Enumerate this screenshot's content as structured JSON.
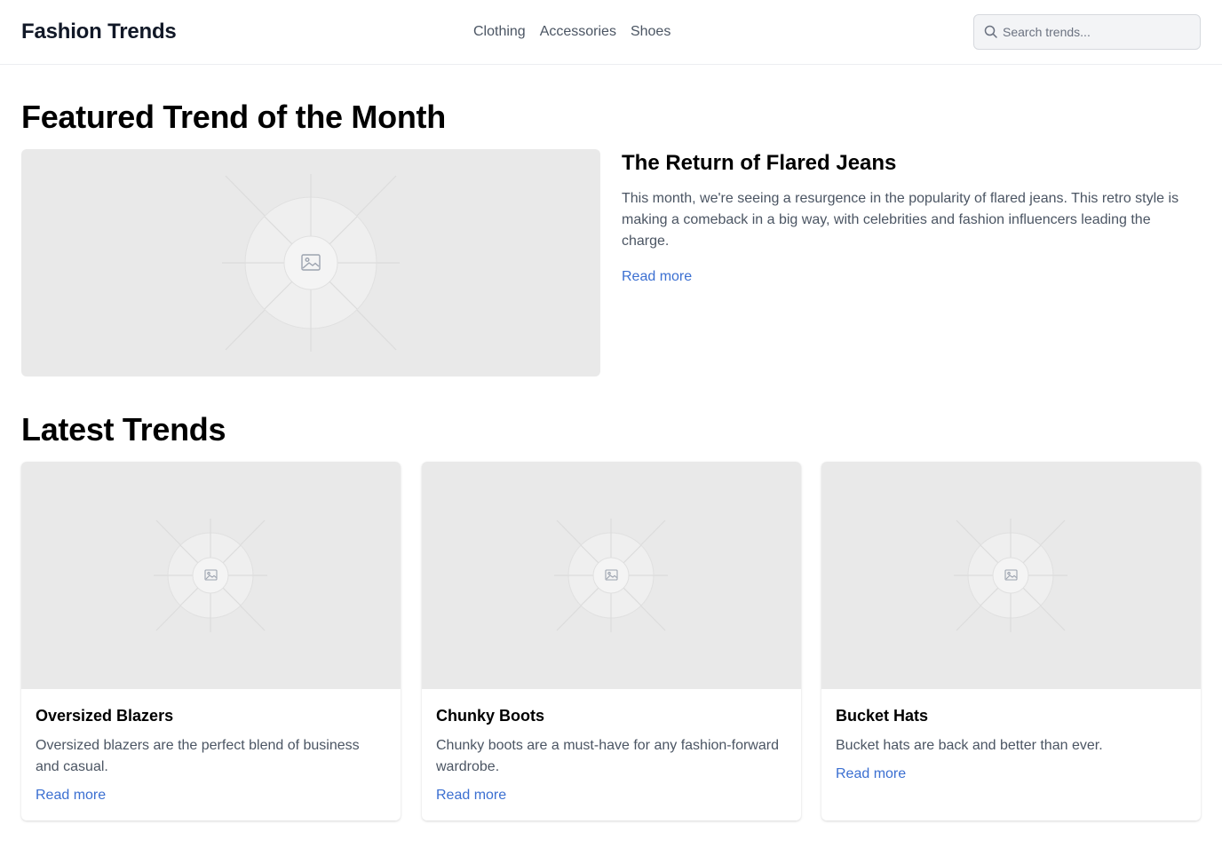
{
  "header": {
    "logo": "Fashion Trends",
    "nav": [
      "Clothing",
      "Accessories",
      "Shoes"
    ],
    "search_placeholder": "Search trends..."
  },
  "featured": {
    "section_title": "Featured Trend of the Month",
    "title": "The Return of Flared Jeans",
    "description": "This month, we're seeing a resurgence in the popularity of flared jeans. This retro style is making a comeback in a big way, with celebrities and fashion influencers leading the charge.",
    "link": "Read more"
  },
  "latest": {
    "section_title": "Latest Trends",
    "cards": [
      {
        "title": "Oversized Blazers",
        "description": "Oversized blazers are the perfect blend of business and casual.",
        "link": "Read more"
      },
      {
        "title": "Chunky Boots",
        "description": "Chunky boots are a must-have for any fashion-forward wardrobe.",
        "link": "Read more"
      },
      {
        "title": "Bucket Hats",
        "description": "Bucket hats are back and better than ever.",
        "link": "Read more"
      }
    ]
  },
  "colors": {
    "link": "#3b6fd1",
    "muted_text": "#4b5563",
    "placeholder_bg": "#e9e9e9"
  }
}
